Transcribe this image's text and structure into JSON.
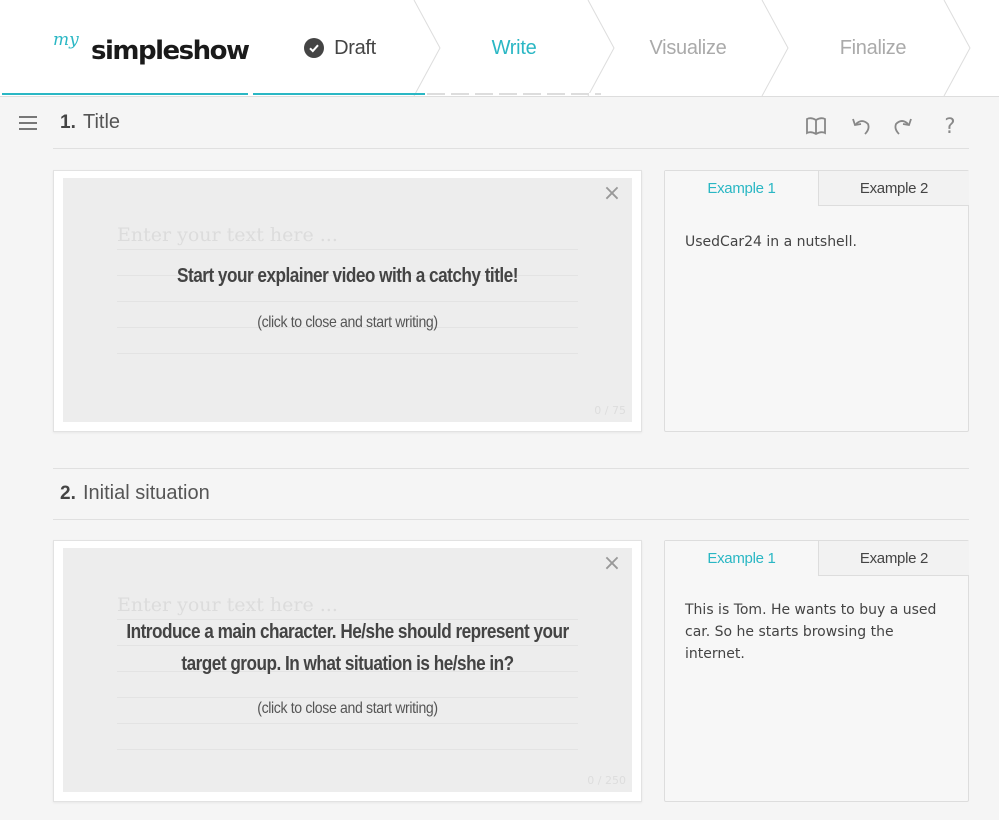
{
  "header": {
    "logo_prefix": "my",
    "logo_brand": "simpleshow",
    "steps": [
      {
        "label": "Draft",
        "state": "done"
      },
      {
        "label": "Write",
        "state": "active"
      },
      {
        "label": "Visualize",
        "state": "upcoming"
      },
      {
        "label": "Finalize",
        "state": "upcoming"
      }
    ]
  },
  "toolbar": {
    "icons": [
      "book-icon",
      "undo-icon",
      "redo-icon",
      "help-icon"
    ],
    "help_label": "?"
  },
  "sections": [
    {
      "number": "1.",
      "title": "Title",
      "placeholder": "Enter your text here ...",
      "overlay_title": "Start your explainer video with a catchy title!",
      "overlay_sub": "(click to close and start writing)",
      "counter": "0 / 75",
      "example_tab_1": "Example 1",
      "example_tab_2": "Example 2",
      "example_text": "UsedCar24 in a nutshell."
    },
    {
      "number": "2.",
      "title": "Initial situation",
      "placeholder": "Enter your text here ...",
      "overlay_title_line1": "Introduce a main character. He/she should represent your",
      "overlay_title_line2": "target group. In what situation is he/she in?",
      "overlay_sub": "(click to close and start writing)",
      "counter": "0 / 250",
      "example_tab_1": "Example 1",
      "example_tab_2": "Example 2",
      "example_text": "This is Tom. He wants to buy a used car. So he starts browsing the internet."
    }
  ],
  "colors": {
    "accent": "#2ab7c4",
    "text": "#444444",
    "muted": "#aaaaaa"
  }
}
